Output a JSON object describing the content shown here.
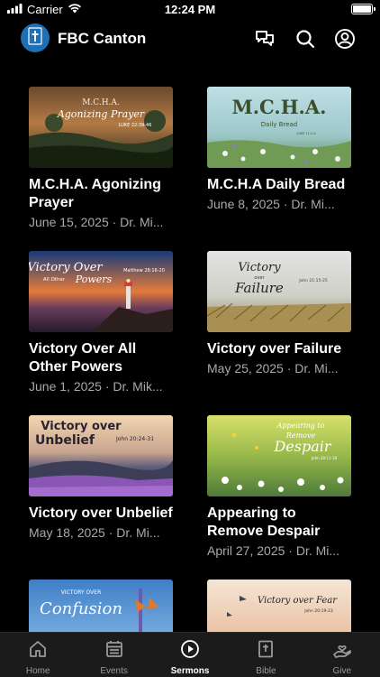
{
  "status_bar": {
    "carrier": "Carrier",
    "time": "12:24 PM"
  },
  "header": {
    "title": "FBC Canton",
    "logo_icon": "cross-icon"
  },
  "sermons": [
    {
      "title": "M.C.H.A. Agonizing Prayer",
      "meta": "June 15, 2025 · Dr. Mi...",
      "thumb_text": [
        "M.C.H.A.",
        "Agonizing Prayer",
        "LUKE 22:39-46"
      ]
    },
    {
      "title": "M.C.H.A Daily Bread",
      "meta": "June 8, 2025 · Dr. Mi...",
      "thumb_text": [
        "M.C.H.A.",
        "Daily Bread",
        "LUKE 11:1-4"
      ]
    },
    {
      "title": "Victory Over All Other Powers",
      "meta": "June 1, 2025 · Dr. Mik...",
      "thumb_text": [
        "Victory Over",
        "All Other",
        "Powers",
        "Matthew 28:16-20"
      ]
    },
    {
      "title": "Victory over Failure",
      "meta": "May 25, 2025 · Dr. Mi...",
      "thumb_text": [
        "Victory",
        "over",
        "Failure",
        "John 21:15-25"
      ]
    },
    {
      "title": "Victory over Unbelief",
      "meta": "May 18, 2025 · Dr. Mi...",
      "thumb_text": [
        "Victory over",
        "Unbelief",
        "John 20:24-31"
      ]
    },
    {
      "title": "Appearing to Remove Despair",
      "meta": "April 27, 2025 · Dr. Mi...",
      "thumb_text": [
        "Appearing to",
        "Remove",
        "Despair",
        "John 20:11-18"
      ]
    },
    {
      "title": "",
      "meta": "",
      "thumb_text": [
        "VICTORY OVER",
        "Confusion"
      ]
    },
    {
      "title": "",
      "meta": "",
      "thumb_text": [
        "Victory over Fear",
        "John 20:19-23"
      ]
    }
  ],
  "tabs": [
    {
      "label": "Home",
      "icon": "home-icon",
      "active": false
    },
    {
      "label": "Events",
      "icon": "calendar-icon",
      "active": false
    },
    {
      "label": "Sermons",
      "icon": "play-circle-icon",
      "active": true
    },
    {
      "label": "Bible",
      "icon": "bible-icon",
      "active": false
    },
    {
      "label": "Give",
      "icon": "give-hand-icon",
      "active": false
    }
  ],
  "colors": {
    "background": "#000000",
    "tabbar": "#1b1b1b",
    "logo": "#1e6fb3",
    "meta_text": "#a9a9a9"
  }
}
